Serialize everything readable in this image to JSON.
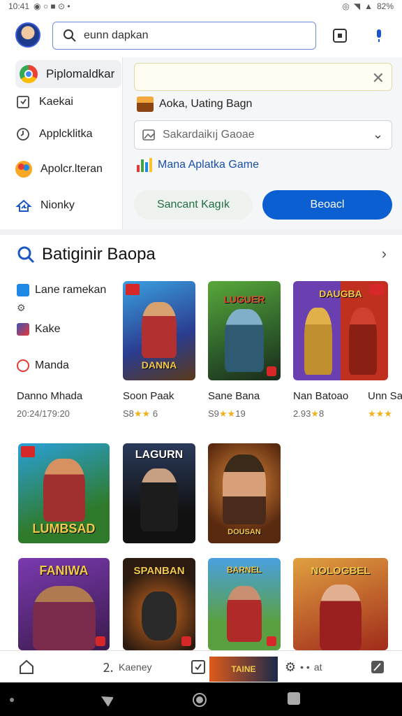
{
  "statusbar": {
    "time": "10:41",
    "battery": "82%"
  },
  "search": {
    "text": "eunn dapkan"
  },
  "left_menu": [
    {
      "label": "Piplomaldkar",
      "icon": "chrome-icon"
    },
    {
      "label": "Kaekai",
      "icon": "calendar-icon"
    },
    {
      "label": "Applcklitka",
      "icon": "clock-icon"
    },
    {
      "label": "Apolcr.lteran",
      "icon": "palette-icon"
    },
    {
      "label": "Nionky",
      "icon": "share-icon"
    }
  ],
  "panel": {
    "row1": "Aoka, Uating Bagn",
    "select_placeholder": "Sakardaikıj Gaoae",
    "row2": "Mana Aplatka Game",
    "secondary_button": "Sancant Kagık",
    "primary_button": "Beoacl"
  },
  "section": {
    "title": "Batiginir Baopa"
  },
  "categories": [
    {
      "label": "Lane ramekan"
    },
    {
      "label": "Kake"
    },
    {
      "label": "Manda"
    }
  ],
  "featured": {
    "name": "Danno Mhada",
    "meta": "20:24/179:20"
  },
  "games_row1": [
    {
      "name": "Soon Paak",
      "rating": "S8",
      "stars": "★★",
      "count": "6",
      "art_title": "DANNA"
    },
    {
      "name": "Sane Bana",
      "rating": "S9",
      "stars": "★★",
      "count": "19",
      "art_title": "LUGUER"
    },
    {
      "name": "Nan Batoao",
      "rating": "2.93",
      "stars": "★",
      "count": "8",
      "art_title": "DAUGBA"
    },
    {
      "name": "Unn Sa",
      "rating": "",
      "stars": "★★★",
      "count": "",
      "art_title": ""
    }
  ],
  "games_row2": [
    {
      "art_title": "LUMBSAD"
    },
    {
      "art_title": "LAGURN"
    },
    {
      "art_title": "DOUSAN"
    }
  ],
  "games_row3": [
    {
      "art_title": "FANIWA"
    },
    {
      "art_title": "SPANBAN"
    },
    {
      "art_title": "BARNEL"
    },
    {
      "art_title": "NOLOGBEL"
    }
  ],
  "bottom_nav": {
    "item2": "Kaeney",
    "item4": "at",
    "promo": "TAINE"
  },
  "colors": {
    "primary": "#0b5fd1",
    "accent_red": "#d62828"
  }
}
